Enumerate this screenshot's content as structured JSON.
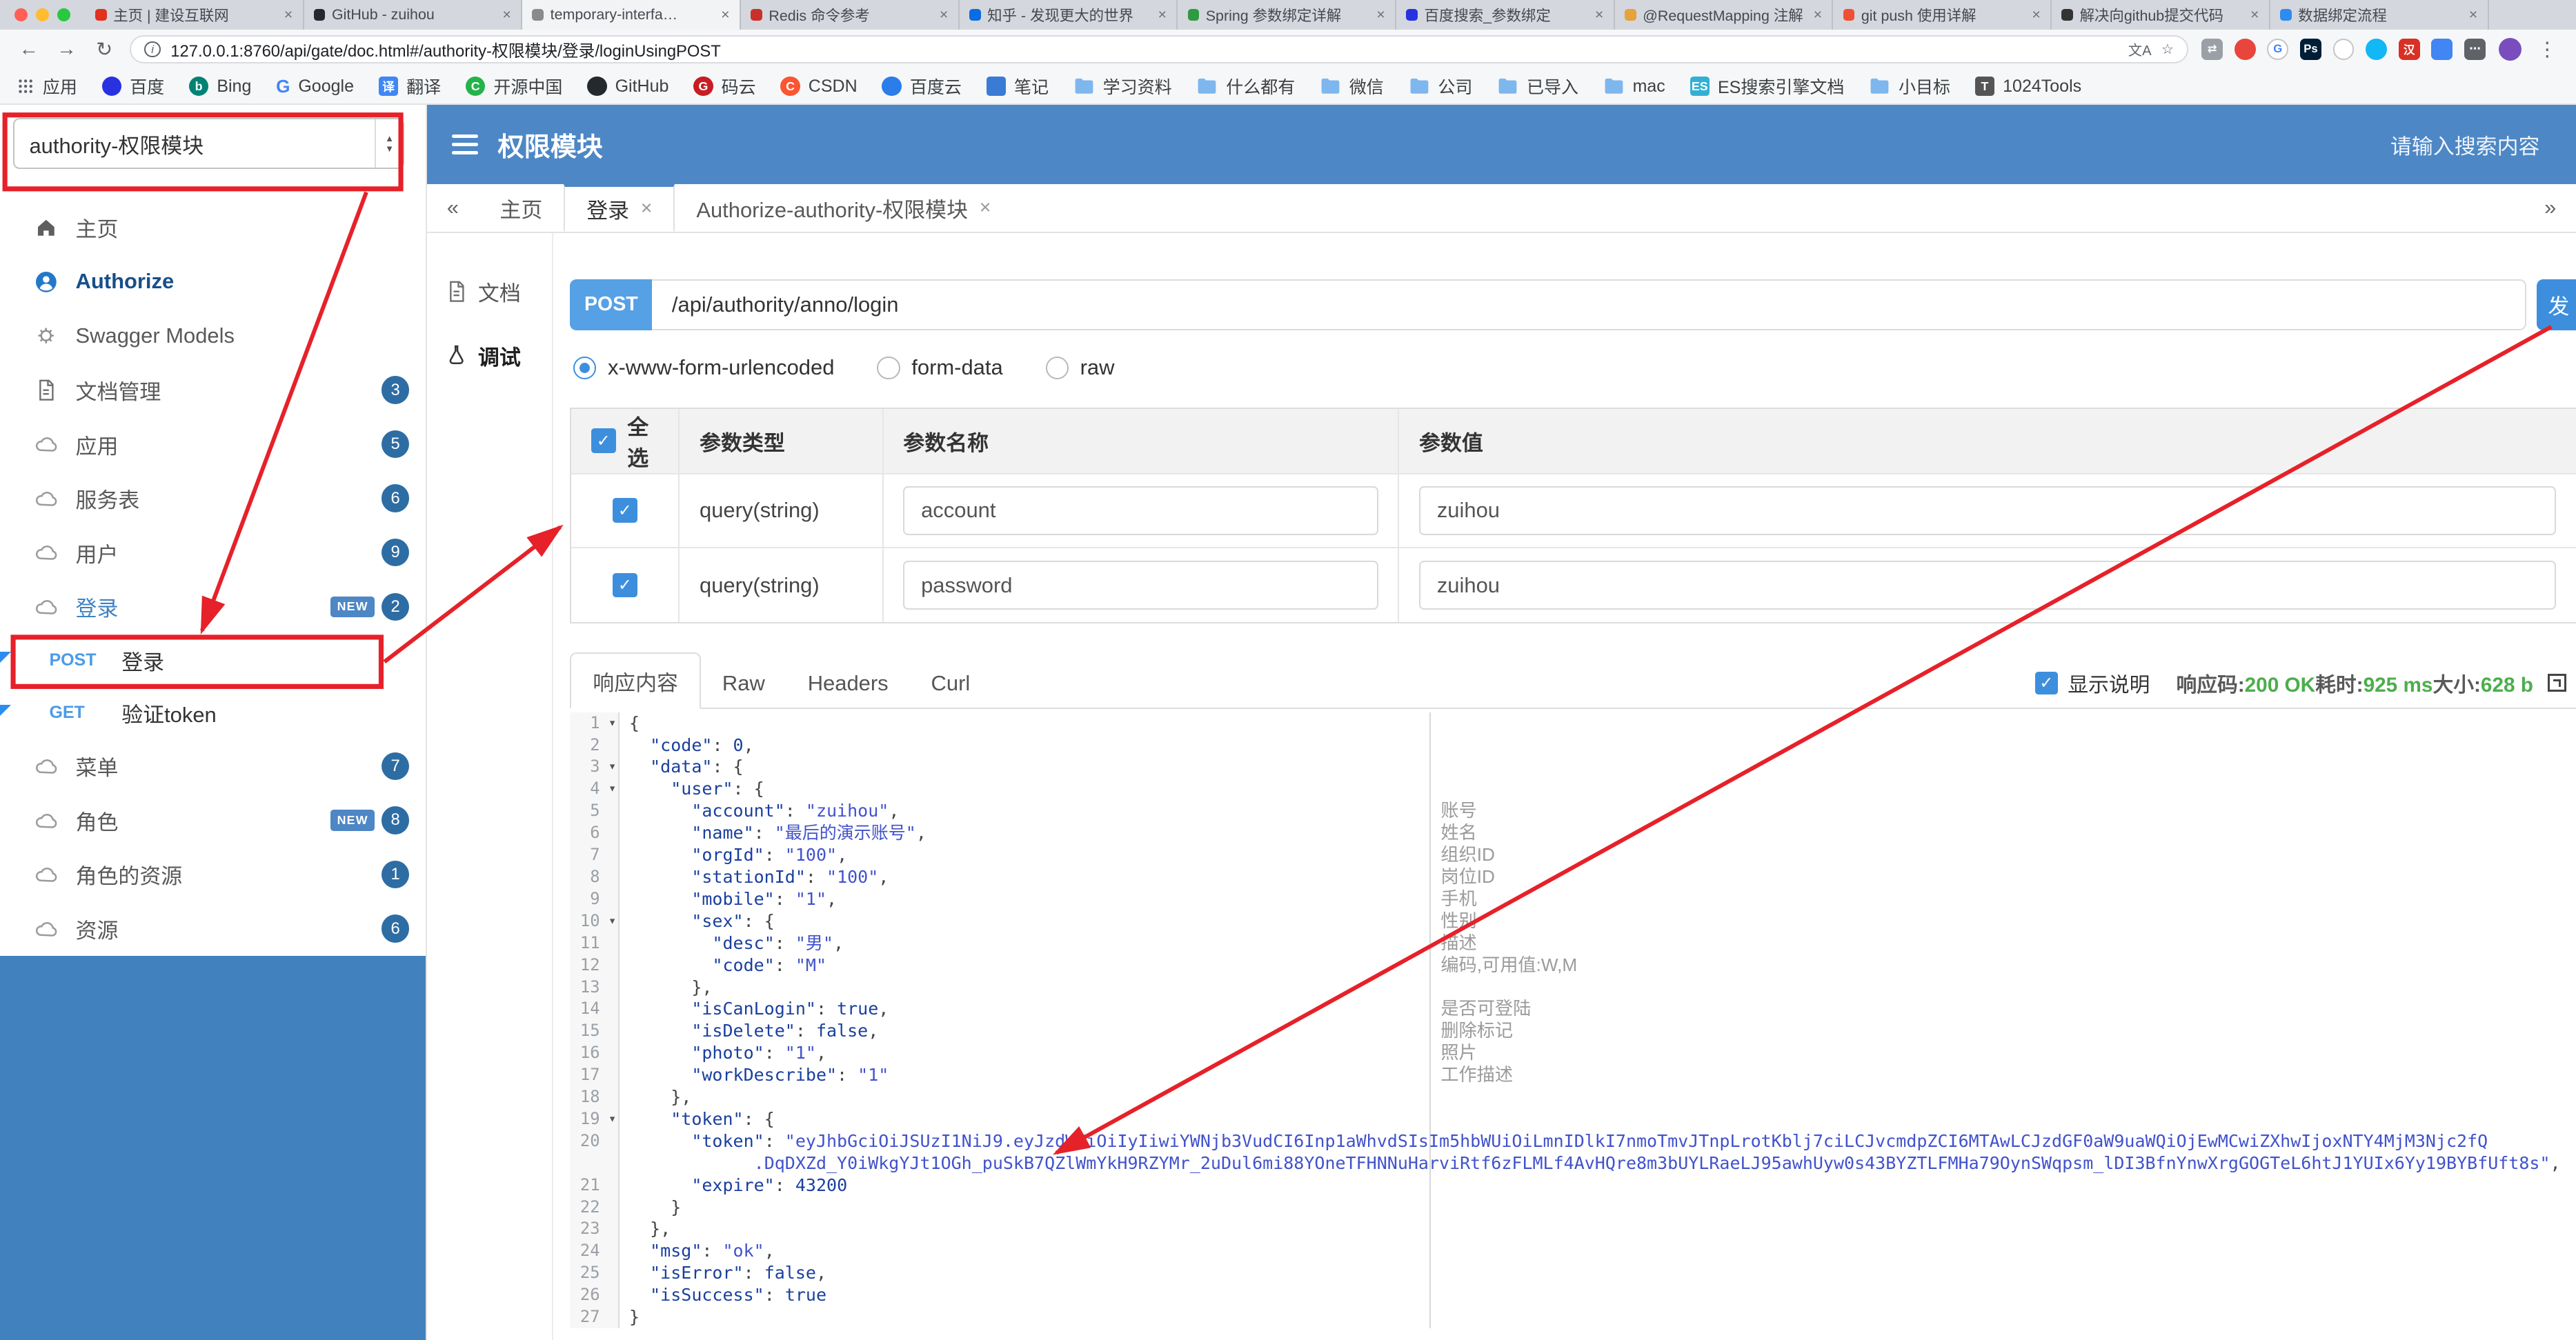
{
  "browser": {
    "url": "127.0.0.1:8760/api/gate/doc.html#/authority-权限模块/登录/loginUsingPOST",
    "tabs": [
      {
        "title": "主页 | 建设互联网",
        "color": "#e0321f"
      },
      {
        "title": "GitHub - zuihou",
        "color": "#24292e"
      },
      {
        "title": "temporary-interfa…",
        "color": "#8a8a8a",
        "active": true
      },
      {
        "title": "Redis 命令参考",
        "color": "#c9302c"
      },
      {
        "title": "知乎 - 发现更大的世界",
        "color": "#0a6ce1"
      },
      {
        "title": "Spring 参数绑定详解",
        "color": "#2f9a41"
      },
      {
        "title": "百度搜索_参数绑定",
        "color": "#2932e1"
      },
      {
        "title": "@RequestMapping 注解",
        "color": "#e6a23c"
      },
      {
        "title": "git push 使用详解",
        "color": "#f05033"
      },
      {
        "title": "解决向github提交代码",
        "color": "#333333"
      },
      {
        "title": "数据绑定流程",
        "color": "#2d8cf0"
      }
    ],
    "extensions": [
      {
        "color": "#9aa0a6",
        "glyph": "⇄"
      },
      {
        "color": "#e8453c",
        "glyph": "",
        "round": true
      },
      {
        "color": "#ffffff",
        "glyph": "G",
        "fg": "#4285f4",
        "border": true,
        "round": true
      },
      {
        "color": "#001e36",
        "glyph": "Ps"
      },
      {
        "color": "#ffffff",
        "glyph": "",
        "border": true,
        "round": true
      },
      {
        "color": "#12b7f5",
        "glyph": "",
        "round": true
      },
      {
        "color": "#d93025",
        "glyph": "汉"
      },
      {
        "color": "#4285f4",
        "glyph": ""
      },
      {
        "color": "#5f6368",
        "glyph": "⋯"
      }
    ],
    "bookmarks": [
      {
        "label": "应用",
        "icon": "apps"
      },
      {
        "label": "百度",
        "icon": "circle",
        "color": "#2932e1"
      },
      {
        "label": "Bing",
        "icon": "circle",
        "color": "#008373",
        "glyph": "b"
      },
      {
        "label": "Google",
        "icon": "google"
      },
      {
        "label": "翻译",
        "icon": "square",
        "color": "#4086f4",
        "glyph": "译"
      },
      {
        "label": "开源中国",
        "icon": "circle",
        "color": "#24b34b",
        "glyph": "C"
      },
      {
        "label": "GitHub",
        "icon": "circle",
        "color": "#24292e"
      },
      {
        "label": "码云",
        "icon": "circle",
        "color": "#c71d23",
        "glyph": "G"
      },
      {
        "label": "CSDN",
        "icon": "circle",
        "color": "#fc5531",
        "glyph": "C"
      },
      {
        "label": "百度云",
        "icon": "circle",
        "color": "#2b7de9"
      },
      {
        "label": "笔记",
        "icon": "square",
        "color": "#3a7bd5"
      },
      {
        "label": "学习资料",
        "icon": "folder"
      },
      {
        "label": "什么都有",
        "icon": "folder"
      },
      {
        "label": "微信",
        "icon": "folder"
      },
      {
        "label": "公司",
        "icon": "folder"
      },
      {
        "label": "已导入",
        "icon": "folder"
      },
      {
        "label": "mac",
        "icon": "folder"
      },
      {
        "label": "ES搜索引擎文档",
        "icon": "square",
        "color": "#31b0d5",
        "glyph": "ES"
      },
      {
        "label": "小目标",
        "icon": "folder"
      },
      {
        "label": "1024Tools",
        "icon": "square",
        "color": "#555555",
        "glyph": "T"
      }
    ]
  },
  "header": {
    "title": "权限模块",
    "search_placeholder": "请输入搜索内容"
  },
  "sidebar": {
    "group_select": "authority-权限模块",
    "items": [
      {
        "label": "主页",
        "icon": "home"
      },
      {
        "label": "Authorize",
        "icon": "person",
        "bold": true
      },
      {
        "label": "Swagger Models",
        "icon": "gear"
      },
      {
        "label": "文档管理",
        "icon": "doc",
        "badge": "3"
      },
      {
        "label": "应用",
        "icon": "cloud",
        "badge": "5"
      },
      {
        "label": "服务表",
        "icon": "cloud",
        "badge": "6"
      },
      {
        "label": "用户",
        "icon": "cloud",
        "badge": "9"
      },
      {
        "label": "登录",
        "icon": "cloud",
        "badge": "2",
        "new": true,
        "active": true
      },
      {
        "type": "api",
        "method": "POST",
        "label": "登录"
      },
      {
        "type": "api",
        "method": "GET",
        "label": "验证token"
      },
      {
        "label": "菜单",
        "icon": "cloud",
        "badge": "7"
      },
      {
        "label": "角色",
        "icon": "cloud",
        "badge": "8",
        "new": true
      },
      {
        "label": "角色的资源",
        "icon": "cloud",
        "badge": "1"
      },
      {
        "label": "资源",
        "icon": "cloud",
        "badge": "6"
      }
    ]
  },
  "tabbar": {
    "left": "«",
    "right": "»",
    "tabs": [
      {
        "label": "主页",
        "closable": false
      },
      {
        "label": "登录",
        "closable": true,
        "active": true
      },
      {
        "label": "Authorize-authority-权限模块",
        "closable": true
      }
    ]
  },
  "subnav": [
    {
      "label": "文档",
      "icon": "doc"
    },
    {
      "label": "调试",
      "icon": "debug",
      "active": true
    }
  ],
  "request": {
    "method": "POST",
    "url": "/api/authority/anno/login",
    "send_label": "发",
    "content_types": [
      {
        "label": "x-www-form-urlencoded",
        "selected": true
      },
      {
        "label": "form-data",
        "selected": false
      },
      {
        "label": "raw",
        "selected": false
      }
    ]
  },
  "params_table": {
    "select_all": "全选",
    "headers": [
      "参数类型",
      "参数名称",
      "参数值"
    ],
    "rows": [
      {
        "checked": true,
        "type": "query(string)",
        "name": "account",
        "value": "zuihou"
      },
      {
        "checked": true,
        "type": "query(string)",
        "name": "password",
        "value": "zuihou"
      }
    ]
  },
  "response": {
    "tabs": [
      "响应内容",
      "Raw",
      "Headers",
      "Curl"
    ],
    "active_tab": "响应内容",
    "show_desc_label": "显示说明",
    "meta": [
      {
        "label": "响应码:",
        "value": "200 OK"
      },
      {
        "label": "耗时:",
        "value": "925 ms"
      },
      {
        "label": "大小:",
        "value": "628 b"
      }
    ]
  },
  "code": {
    "lines": [
      {
        "n": 1,
        "fold": true,
        "t": [
          [
            "p",
            "{"
          ]
        ]
      },
      {
        "n": 2,
        "t": [
          [
            "p",
            "  "
          ],
          [
            "k",
            "\"code\""
          ],
          [
            "p",
            ": "
          ],
          [
            "d",
            "0"
          ],
          [
            "p",
            ","
          ]
        ]
      },
      {
        "n": 3,
        "fold": true,
        "t": [
          [
            "p",
            "  "
          ],
          [
            "k",
            "\"data\""
          ],
          [
            "p",
            ": {"
          ]
        ]
      },
      {
        "n": 4,
        "fold": true,
        "t": [
          [
            "p",
            "    "
          ],
          [
            "k",
            "\"user\""
          ],
          [
            "p",
            ": {"
          ]
        ]
      },
      {
        "n": 5,
        "d": "账号",
        "t": [
          [
            "p",
            "      "
          ],
          [
            "k",
            "\"account\""
          ],
          [
            "p",
            ": "
          ],
          [
            "s",
            "\"zuihou\""
          ],
          [
            "p",
            ","
          ]
        ]
      },
      {
        "n": 6,
        "d": "姓名",
        "t": [
          [
            "p",
            "      "
          ],
          [
            "k",
            "\"name\""
          ],
          [
            "p",
            ": "
          ],
          [
            "s",
            "\"最后的演示账号\""
          ],
          [
            "p",
            ","
          ]
        ]
      },
      {
        "n": 7,
        "d": "组织ID",
        "t": [
          [
            "p",
            "      "
          ],
          [
            "k",
            "\"orgId\""
          ],
          [
            "p",
            ": "
          ],
          [
            "s",
            "\"100\""
          ],
          [
            "p",
            ","
          ]
        ]
      },
      {
        "n": 8,
        "d": "岗位ID",
        "t": [
          [
            "p",
            "      "
          ],
          [
            "k",
            "\"stationId\""
          ],
          [
            "p",
            ": "
          ],
          [
            "s",
            "\"100\""
          ],
          [
            "p",
            ","
          ]
        ]
      },
      {
        "n": 9,
        "d": "手机",
        "t": [
          [
            "p",
            "      "
          ],
          [
            "k",
            "\"mobile\""
          ],
          [
            "p",
            ": "
          ],
          [
            "s",
            "\"1\""
          ],
          [
            "p",
            ","
          ]
        ]
      },
      {
        "n": 10,
        "d": "性别",
        "fold": true,
        "t": [
          [
            "p",
            "      "
          ],
          [
            "k",
            "\"sex\""
          ],
          [
            "p",
            ": {"
          ]
        ]
      },
      {
        "n": 11,
        "d": "描述",
        "t": [
          [
            "p",
            "        "
          ],
          [
            "k",
            "\"desc\""
          ],
          [
            "p",
            ": "
          ],
          [
            "s",
            "\"男\""
          ],
          [
            "p",
            ","
          ]
        ]
      },
      {
        "n": 12,
        "d": "编码,可用值:W,M",
        "t": [
          [
            "p",
            "        "
          ],
          [
            "k",
            "\"code\""
          ],
          [
            "p",
            ": "
          ],
          [
            "s",
            "\"M\""
          ]
        ]
      },
      {
        "n": 13,
        "t": [
          [
            "p",
            "      },"
          ]
        ]
      },
      {
        "n": 14,
        "d": "是否可登陆",
        "t": [
          [
            "p",
            "      "
          ],
          [
            "k",
            "\"isCanLogin\""
          ],
          [
            "p",
            ": "
          ],
          [
            "b",
            "true"
          ],
          [
            "p",
            ","
          ]
        ]
      },
      {
        "n": 15,
        "d": "删除标记",
        "t": [
          [
            "p",
            "      "
          ],
          [
            "k",
            "\"isDelete\""
          ],
          [
            "p",
            ": "
          ],
          [
            "b",
            "false"
          ],
          [
            "p",
            ","
          ]
        ]
      },
      {
        "n": 16,
        "d": "照片",
        "t": [
          [
            "p",
            "      "
          ],
          [
            "k",
            "\"photo\""
          ],
          [
            "p",
            ": "
          ],
          [
            "s",
            "\"1\""
          ],
          [
            "p",
            ","
          ]
        ]
      },
      {
        "n": 17,
        "d": "工作描述",
        "t": [
          [
            "p",
            "      "
          ],
          [
            "k",
            "\"workDescribe\""
          ],
          [
            "p",
            ": "
          ],
          [
            "s",
            "\"1\""
          ]
        ]
      },
      {
        "n": 18,
        "t": [
          [
            "p",
            "    },"
          ]
        ]
      },
      {
        "n": 19,
        "fold": true,
        "t": [
          [
            "p",
            "    "
          ],
          [
            "k",
            "\"token\""
          ],
          [
            "p",
            ": {"
          ]
        ]
      },
      {
        "n": 20,
        "t": [
          [
            "p",
            "      "
          ],
          [
            "k",
            "\"token\""
          ],
          [
            "p",
            ": "
          ],
          [
            "s",
            "\"eyJhbGciOiJSUzI1NiJ9.eyJzdWIiOiIyIiwiYWNjb3VudCI6Inp1aWhvdSIsIm5hbWUiOiLmnIDlkI7nmoTmvJTnpLrotKblj7ciLCJvcmdpZCI6MTAwLCJzdGF0aW9uaWQiOjEwMCwiZXhwIjoxNTY4MjM3Njc2fQ"
          ]
        ],
        "t2": [
          [
            "p",
            "            "
          ],
          [
            "s",
            ".DqDXZd_Y0iWkgYJt1OGh_puSkB7QZlWmYkH9RZYMr_2uDul6mi88YOneTFHNNuHarviRtf6zFLMLf4AvHQre8m3bUYLRaeLJ95awhUyw0s43BYZTLFMHa79OynSWqpsm_lDI3BfnYnwXrgGOGTeL6htJ1YUIx6Yy19BYBfUft8s\""
          ],
          [
            "p",
            ","
          ]
        ]
      },
      {
        "n": 21,
        "t": [
          [
            "p",
            "      "
          ],
          [
            "k",
            "\"expire\""
          ],
          [
            "p",
            ": "
          ],
          [
            "d",
            "43200"
          ]
        ]
      },
      {
        "n": 22,
        "t": [
          [
            "p",
            "    }"
          ]
        ]
      },
      {
        "n": 23,
        "t": [
          [
            "p",
            "  },"
          ]
        ]
      },
      {
        "n": 24,
        "t": [
          [
            "p",
            "  "
          ],
          [
            "k",
            "\"msg\""
          ],
          [
            "p",
            ": "
          ],
          [
            "s",
            "\"ok\""
          ],
          [
            "p",
            ","
          ]
        ]
      },
      {
        "n": 25,
        "t": [
          [
            "p",
            "  "
          ],
          [
            "k",
            "\"isError\""
          ],
          [
            "p",
            ": "
          ],
          [
            "b",
            "false"
          ],
          [
            "p",
            ","
          ]
        ]
      },
      {
        "n": 26,
        "t": [
          [
            "p",
            "  "
          ],
          [
            "k",
            "\"isSuccess\""
          ],
          [
            "p",
            ": "
          ],
          [
            "b",
            "true"
          ]
        ]
      },
      {
        "n": 27,
        "t": [
          [
            "p",
            "}"
          ]
        ]
      }
    ]
  }
}
